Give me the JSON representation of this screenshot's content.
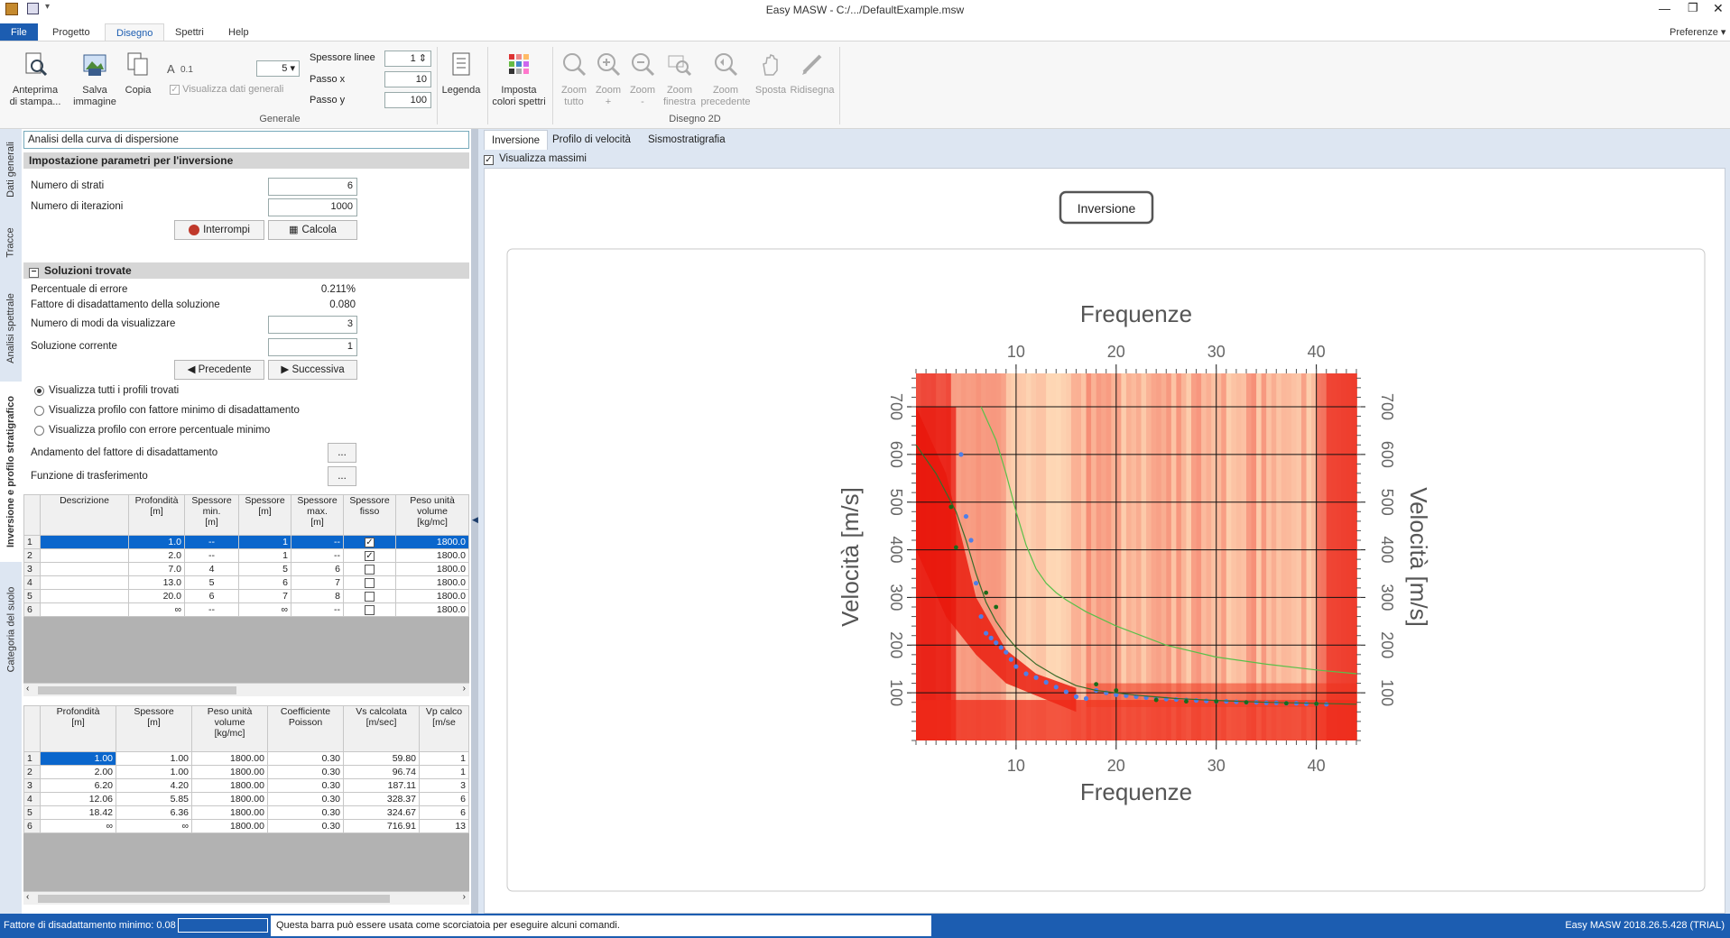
{
  "window": {
    "title": "Easy MASW - C:/.../DefaultExample.msw"
  },
  "menu_tabs": [
    "File",
    "Progetto",
    "Disegno",
    "Spettri",
    "Help"
  ],
  "preferences_label": "Preferenze",
  "ribbon": {
    "preview": "Anteprima\ndi stampa...",
    "save_image": "Salva\nimmagine",
    "copy": "Copia",
    "font_size": "0.1",
    "font_select": "5",
    "show_general_data": "Visualizza dati generali",
    "line_thickness_label": "Spessore linee",
    "line_thickness_value": "1",
    "step_x_label": "Passo x",
    "step_x_value": "10",
    "step_y_label": "Passo y",
    "step_y_value": "100",
    "legend": "Legenda",
    "set_spectra_colors": "Imposta\ncolori spettri",
    "group_general": "Generale",
    "zoom_all": "Zoom\ntutto",
    "zoom_in": "Zoom\n+",
    "zoom_out": "Zoom\n-",
    "zoom_window": "Zoom\nfinestra",
    "zoom_prev": "Zoom\nprecedente",
    "move": "Sposta",
    "redraw": "Ridisegna",
    "group_2d": "Disegno 2D"
  },
  "vertical_tabs": [
    "Dati generali",
    "Tracce",
    "Analisi spettrale",
    "Inversione e profilo stratigrafico",
    "Categoria del suolo"
  ],
  "left": {
    "dispersion_field": "Analisi della curva di dispersione",
    "inv_section": "Impostazione parametri per l'inversione",
    "num_layers_label": "Numero di strati",
    "num_layers": "6",
    "num_iter_label": "Numero di iterazioni",
    "num_iter": "1000",
    "stop_btn": "Interrompi",
    "calc_btn": "Calcola",
    "sol_section": "Soluzioni trovate",
    "error_pct_label": "Percentuale di errore",
    "error_pct": "0.211%",
    "mismatch_label": "Fattore di disadattamento della soluzione",
    "mismatch": "0.080",
    "modes_label": "Numero di modi da visualizzare",
    "modes": "3",
    "current_label": "Soluzione corrente",
    "current": "1",
    "prev_btn": "Precedente",
    "next_btn": "Successiva",
    "radio1": "Visualizza tutti i profili trovati",
    "radio2": "Visualizza profilo con fattore minimo di disadattamento",
    "radio3": "Visualizza profilo con errore percentuale minimo",
    "trend_label": "Andamento del fattore di disadattamento",
    "transfer_label": "Funzione di trasferimento",
    "ellipsis": "..."
  },
  "grid1": {
    "headers": [
      "Descrizione",
      "Profondità\n[m]",
      "Spessore\nmin.\n[m]",
      "Spessore\n[m]",
      "Spessore\nmax.\n[m]",
      "Spessore\nfisso",
      "Peso unità\nvolume\n[kg/mc]"
    ],
    "rows": [
      [
        "1",
        "",
        "1.0",
        "--",
        "1",
        "--",
        "x",
        "1800.0"
      ],
      [
        "2",
        "",
        "2.0",
        "--",
        "1",
        "--",
        "x",
        "1800.0"
      ],
      [
        "3",
        "",
        "7.0",
        "4",
        "5",
        "6",
        "",
        "1800.0"
      ],
      [
        "4",
        "",
        "13.0",
        "5",
        "6",
        "7",
        "",
        "1800.0"
      ],
      [
        "5",
        "",
        "20.0",
        "6",
        "7",
        "8",
        "",
        "1800.0"
      ],
      [
        "6",
        "",
        "∞",
        "--",
        "∞",
        "--",
        "",
        "1800.0"
      ]
    ]
  },
  "grid2": {
    "headers": [
      "Profondità\n[m]",
      "Spessore\n[m]",
      "Peso unità\nvolume\n[kg/mc]",
      "Coefficiente\nPoisson",
      "Vs calcolata\n[m/sec]",
      "Vp calco\n[m/se"
    ],
    "rows": [
      [
        "1",
        "1.00",
        "1.00",
        "1800.00",
        "0.30",
        "59.80",
        "1"
      ],
      [
        "2",
        "2.00",
        "1.00",
        "1800.00",
        "0.30",
        "96.74",
        "1"
      ],
      [
        "3",
        "6.20",
        "4.20",
        "1800.00",
        "0.30",
        "187.11",
        "3"
      ],
      [
        "4",
        "12.06",
        "5.85",
        "1800.00",
        "0.30",
        "328.37",
        "6"
      ],
      [
        "5",
        "18.42",
        "6.36",
        "1800.00",
        "0.30",
        "324.67",
        "6"
      ],
      [
        "6",
        "∞",
        "∞",
        "1800.00",
        "0.30",
        "716.91",
        "13"
      ]
    ]
  },
  "chart_tabs": [
    "Inversione",
    "Profilo di velocità",
    "Sismostratigrafia"
  ],
  "show_max_label": "Visualizza massimi",
  "chart_title_box": "Inversione",
  "status": {
    "left": "Fattore di disadattamento minimo: 0.08",
    "hint": "Questa barra può essere usata come scorciatoia per eseguire alcuni comandi.",
    "right": "Easy MASW 2018.26.5.428 (TRIAL)"
  },
  "chart_data": {
    "type": "heatmap",
    "title": "Frequenze",
    "xlabel": "Frequenze",
    "ylabel": "Velocità [m/s]",
    "xlim": [
      0,
      44
    ],
    "ylim": [
      0,
      770
    ],
    "xticks": [
      10,
      20,
      30,
      40
    ],
    "yticks": [
      100,
      200,
      300,
      400,
      500,
      600,
      700
    ],
    "grid": true,
    "series": [
      {
        "name": "",
        "type": "scatter",
        "color": "#4f7fe8",
        "x": [
          4.5,
          5,
          5.5,
          6,
          6.5,
          7,
          7.5,
          8,
          8.5,
          9,
          9.5,
          10,
          11,
          12,
          13,
          14,
          15,
          16,
          17,
          18,
          19,
          20,
          21,
          22,
          23,
          24,
          25,
          26,
          27,
          28,
          29,
          30,
          31,
          32,
          33,
          34,
          35,
          36,
          37,
          38,
          39,
          40,
          41
        ],
        "y": [
          600,
          470,
          420,
          330,
          260,
          225,
          215,
          205,
          195,
          185,
          170,
          155,
          140,
          132,
          122,
          112,
          102,
          92,
          88,
          105,
          100,
          96,
          94,
          92,
          90,
          88,
          87,
          86,
          85,
          84,
          83,
          82,
          82,
          81,
          80,
          80,
          79,
          79,
          78,
          78,
          77,
          77,
          76
        ]
      },
      {
        "name": "",
        "type": "line",
        "color": "#59c04a",
        "x": [
          6.5,
          8,
          9,
          10,
          11,
          12,
          13,
          14,
          15,
          17,
          20,
          25,
          30,
          35,
          40,
          44
        ],
        "y": [
          700,
          630,
          560,
          480,
          410,
          360,
          330,
          310,
          295,
          270,
          240,
          200,
          175,
          160,
          148,
          140
        ]
      },
      {
        "name": "",
        "type": "line",
        "color": "#3a6b2a",
        "x": [
          0,
          2,
          4,
          5,
          6,
          7,
          8,
          9,
          10,
          12,
          14,
          16,
          18,
          22,
          26,
          30,
          35,
          40,
          44
        ],
        "y": [
          620,
          560,
          480,
          420,
          350,
          290,
          250,
          220,
          195,
          160,
          135,
          115,
          105,
          95,
          88,
          84,
          80,
          78,
          76
        ]
      },
      {
        "name": "",
        "type": "scatter",
        "color": "#1a6b1a",
        "x": [
          3.5,
          4,
          7,
          8,
          18,
          20,
          24,
          27,
          30,
          33,
          37,
          40
        ],
        "y": [
          490,
          405,
          310,
          280,
          118,
          105,
          85,
          82,
          82,
          80,
          78,
          77
        ]
      }
    ]
  }
}
